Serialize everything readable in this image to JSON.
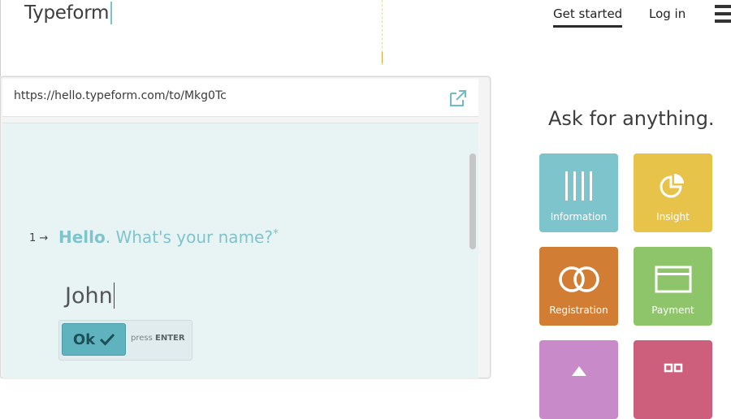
{
  "header": {
    "logo": "Typeform",
    "nav": {
      "get_started": "Get started",
      "login": "Log in"
    },
    "menu_icon": "hamburger-icon"
  },
  "browser": {
    "url": "https://hello.typeform.com/to/Mkg0Tc",
    "external_icon": "external-link-icon"
  },
  "form": {
    "question_number": "1",
    "question_bold": "Hello",
    "question_rest": ". What's your name?",
    "required_mark": "*",
    "answer": "John",
    "ok_label": "Ok",
    "press_prefix": "press",
    "press_key": "ENTER"
  },
  "panel": {
    "title": "Ask for anything.",
    "tiles": [
      {
        "label": "Information",
        "icon": "bars-icon",
        "color": "#7ec4cd"
      },
      {
        "label": "Insight",
        "icon": "pie-chart-icon",
        "color": "#e7c349"
      },
      {
        "label": "Registration",
        "icon": "rings-icon",
        "color": "#d27d34"
      },
      {
        "label": "Payment",
        "icon": "card-icon",
        "color": "#8ec46a"
      },
      {
        "label": "",
        "icon": "triangle-icon",
        "color": "#c98ac9"
      },
      {
        "label": "",
        "icon": "grid-icon",
        "color": "#cd5f7d"
      }
    ]
  },
  "colors": {
    "accent": "#7ec4cd",
    "ok_button": "#5fb3bf",
    "form_background": "#e8f3f4"
  }
}
